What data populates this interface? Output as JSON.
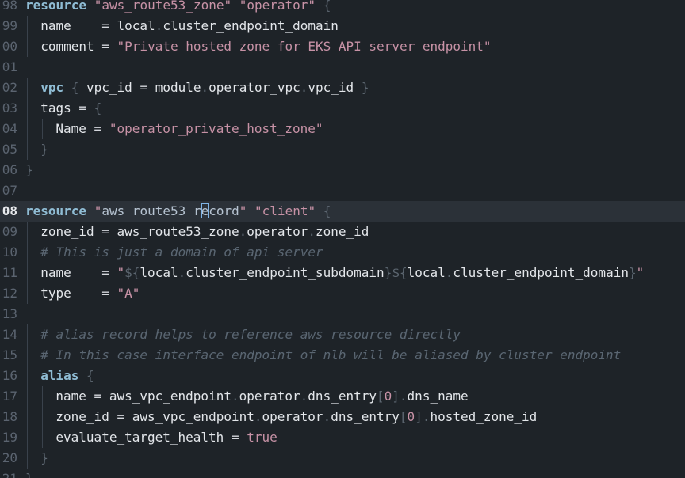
{
  "editor": {
    "lines": [
      {
        "number": "98",
        "tokens": [
          {
            "t": "kw",
            "v": "resource"
          },
          {
            "t": "op",
            "v": " "
          },
          {
            "t": "str",
            "v": "\"aws_route53_zone\""
          },
          {
            "t": "op",
            "v": " "
          },
          {
            "t": "str",
            "v": "\"operator\""
          },
          {
            "t": "op",
            "v": " "
          },
          {
            "t": "punct",
            "v": "{"
          }
        ]
      },
      {
        "number": "99",
        "indent": 1,
        "tokens": [
          {
            "t": "ident",
            "v": "name"
          },
          {
            "t": "op",
            "v": "    = "
          },
          {
            "t": "ident",
            "v": "local"
          },
          {
            "t": "punct",
            "v": "."
          },
          {
            "t": "ident",
            "v": "cluster_endpoint_domain"
          }
        ]
      },
      {
        "number": "00",
        "indent": 1,
        "tokens": [
          {
            "t": "ident",
            "v": "comment"
          },
          {
            "t": "op",
            "v": " = "
          },
          {
            "t": "str",
            "v": "\"Private hosted zone for EKS API server endpoint\""
          }
        ]
      },
      {
        "number": "01",
        "tokens": []
      },
      {
        "number": "02",
        "indent": 1,
        "tokens": [
          {
            "t": "kw",
            "v": "vpc"
          },
          {
            "t": "op",
            "v": " "
          },
          {
            "t": "punct",
            "v": "{"
          },
          {
            "t": "op",
            "v": " "
          },
          {
            "t": "ident",
            "v": "vpc_id"
          },
          {
            "t": "op",
            "v": " = "
          },
          {
            "t": "ident",
            "v": "module"
          },
          {
            "t": "punct",
            "v": "."
          },
          {
            "t": "ident",
            "v": "operator_vpc"
          },
          {
            "t": "punct",
            "v": "."
          },
          {
            "t": "ident",
            "v": "vpc_id"
          },
          {
            "t": "op",
            "v": " "
          },
          {
            "t": "punct",
            "v": "}"
          }
        ]
      },
      {
        "number": "03",
        "indent": 1,
        "tokens": [
          {
            "t": "ident",
            "v": "tags"
          },
          {
            "t": "op",
            "v": " = "
          },
          {
            "t": "punct",
            "v": "{"
          }
        ]
      },
      {
        "number": "04",
        "indent": 2,
        "tokens": [
          {
            "t": "ident",
            "v": "Name"
          },
          {
            "t": "op",
            "v": " = "
          },
          {
            "t": "str",
            "v": "\"operator_private_host_zone\""
          }
        ]
      },
      {
        "number": "05",
        "indent": 1,
        "tokens": [
          {
            "t": "punct",
            "v": "}"
          }
        ]
      },
      {
        "number": "06",
        "tokens": [
          {
            "t": "punct",
            "v": "}"
          }
        ]
      },
      {
        "number": "07",
        "tokens": []
      },
      {
        "number": "08",
        "current": true,
        "tokens": [
          {
            "t": "kw",
            "v": "resource"
          },
          {
            "t": "op",
            "v": " "
          },
          {
            "t": "str",
            "v": "\""
          },
          {
            "t": "link",
            "v": "aws_route53_r"
          },
          {
            "t": "link cursor-box",
            "v": "e"
          },
          {
            "t": "link",
            "v": "cord"
          },
          {
            "t": "str",
            "v": "\""
          },
          {
            "t": "op",
            "v": " "
          },
          {
            "t": "str",
            "v": "\"client\""
          },
          {
            "t": "op",
            "v": " "
          },
          {
            "t": "punct",
            "v": "{"
          }
        ]
      },
      {
        "number": "09",
        "indent": 1,
        "tokens": [
          {
            "t": "ident",
            "v": "zone_id"
          },
          {
            "t": "op",
            "v": " = "
          },
          {
            "t": "ident",
            "v": "aws_route53_zone"
          },
          {
            "t": "punct",
            "v": "."
          },
          {
            "t": "ident",
            "v": "operator"
          },
          {
            "t": "punct",
            "v": "."
          },
          {
            "t": "ident",
            "v": "zone_id"
          }
        ]
      },
      {
        "number": "10",
        "indent": 1,
        "tokens": [
          {
            "t": "cmt",
            "v": "# This is just a domain of api server"
          }
        ]
      },
      {
        "number": "11",
        "indent": 1,
        "tokens": [
          {
            "t": "ident",
            "v": "name"
          },
          {
            "t": "op",
            "v": "    = "
          },
          {
            "t": "str",
            "v": "\""
          },
          {
            "t": "punct",
            "v": "${"
          },
          {
            "t": "ident",
            "v": "local"
          },
          {
            "t": "punct",
            "v": "."
          },
          {
            "t": "ident",
            "v": "cluster_endpoint_subdomain"
          },
          {
            "t": "punct",
            "v": "}${"
          },
          {
            "t": "ident",
            "v": "local"
          },
          {
            "t": "punct",
            "v": "."
          },
          {
            "t": "ident",
            "v": "cluster_endpoint_domain"
          },
          {
            "t": "punct",
            "v": "}"
          },
          {
            "t": "str",
            "v": "\""
          }
        ]
      },
      {
        "number": "12",
        "indent": 1,
        "tokens": [
          {
            "t": "ident",
            "v": "type"
          },
          {
            "t": "op",
            "v": "    = "
          },
          {
            "t": "str",
            "v": "\"A\""
          }
        ]
      },
      {
        "number": "13",
        "tokens": []
      },
      {
        "number": "14",
        "indent": 1,
        "tokens": [
          {
            "t": "cmt",
            "v": "# alias record helps to reference aws resource directly"
          }
        ]
      },
      {
        "number": "15",
        "indent": 1,
        "tokens": [
          {
            "t": "cmt",
            "v": "# In this case interface endpoint of nlb will be aliased by cluster endpoint"
          }
        ]
      },
      {
        "number": "16",
        "indent": 1,
        "tokens": [
          {
            "t": "kw",
            "v": "alias"
          },
          {
            "t": "op",
            "v": " "
          },
          {
            "t": "punct",
            "v": "{"
          }
        ]
      },
      {
        "number": "17",
        "indent": 2,
        "tokens": [
          {
            "t": "ident",
            "v": "name"
          },
          {
            "t": "op",
            "v": " = "
          },
          {
            "t": "ident",
            "v": "aws_vpc_endpoint"
          },
          {
            "t": "punct",
            "v": "."
          },
          {
            "t": "ident",
            "v": "operator"
          },
          {
            "t": "punct",
            "v": "."
          },
          {
            "t": "ident",
            "v": "dns_entry"
          },
          {
            "t": "punct",
            "v": "["
          },
          {
            "t": "num",
            "v": "0"
          },
          {
            "t": "punct",
            "v": "]."
          },
          {
            "t": "ident",
            "v": "dns_name"
          }
        ]
      },
      {
        "number": "18",
        "indent": 2,
        "tokens": [
          {
            "t": "ident",
            "v": "zone_id"
          },
          {
            "t": "op",
            "v": " = "
          },
          {
            "t": "ident",
            "v": "aws_vpc_endpoint"
          },
          {
            "t": "punct",
            "v": "."
          },
          {
            "t": "ident",
            "v": "operator"
          },
          {
            "t": "punct",
            "v": "."
          },
          {
            "t": "ident",
            "v": "dns_entry"
          },
          {
            "t": "punct",
            "v": "["
          },
          {
            "t": "num",
            "v": "0"
          },
          {
            "t": "punct",
            "v": "]."
          },
          {
            "t": "ident",
            "v": "hosted_zone_id"
          }
        ]
      },
      {
        "number": "19",
        "indent": 2,
        "tokens": [
          {
            "t": "ident",
            "v": "evaluate_target_health"
          },
          {
            "t": "op",
            "v": " = "
          },
          {
            "t": "bool",
            "v": "true"
          }
        ]
      },
      {
        "number": "20",
        "indent": 1,
        "tokens": [
          {
            "t": "punct",
            "v": "}"
          }
        ]
      },
      {
        "number": "21",
        "tokens": [
          {
            "t": "punct",
            "v": "}"
          }
        ]
      }
    ]
  }
}
